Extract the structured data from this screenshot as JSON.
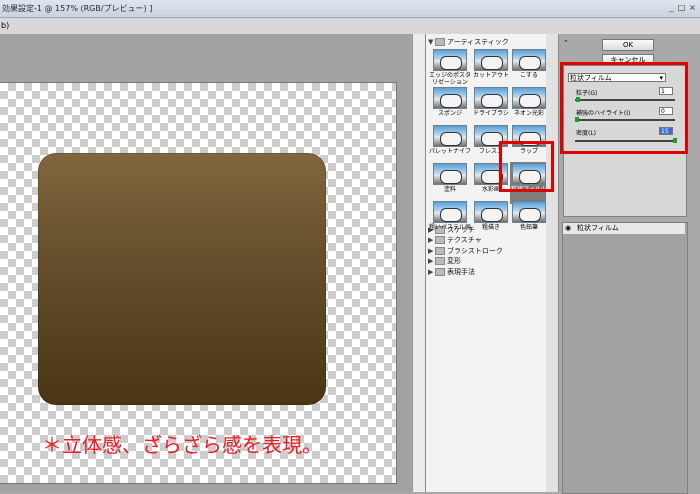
{
  "window": {
    "title": "効果設定-1 @ 157% (RGB/プレビュー) ]",
    "menu_label": "b)"
  },
  "annotation": {
    "text": "＊立体感、ざらざら感を表現。",
    "color": "#ee1c25"
  },
  "gallery": {
    "open_folder": "アーティスティック",
    "thumbnails": [
      {
        "label": "エッジのポスタリゼーション"
      },
      {
        "label": "カットアウト"
      },
      {
        "label": "こする"
      },
      {
        "label": "スポンジ"
      },
      {
        "label": "ドライブラシ"
      },
      {
        "label": "ネオン光彩"
      },
      {
        "label": "パレットナイフ"
      },
      {
        "label": "フレスコ"
      },
      {
        "label": "ラップ"
      },
      {
        "label": "塗料"
      },
      {
        "label": "水彩画"
      },
      {
        "label": "粒状フィルム",
        "selected": true
      },
      {
        "label": "粗いパステル画"
      },
      {
        "label": "粗描き"
      },
      {
        "label": "色鉛筆"
      }
    ],
    "folders": [
      "スケッチ",
      "テクスチャ",
      "ブラシストローク",
      "変形",
      "表現手法"
    ]
  },
  "buttons": {
    "ok": "OK",
    "cancel": "キャンセル"
  },
  "settings": {
    "filter_select": "粒状フィルム",
    "params": [
      {
        "label": "粒子(G)",
        "value": "1"
      },
      {
        "label": "補強のハイライト(I)",
        "value": "0"
      },
      {
        "label": "密度(L)",
        "value": "15"
      }
    ]
  },
  "layer": {
    "name": "粒状フィルム"
  },
  "colors": {
    "highlight_box": "#e00000",
    "slider_thumb": "#1c9d2a"
  }
}
